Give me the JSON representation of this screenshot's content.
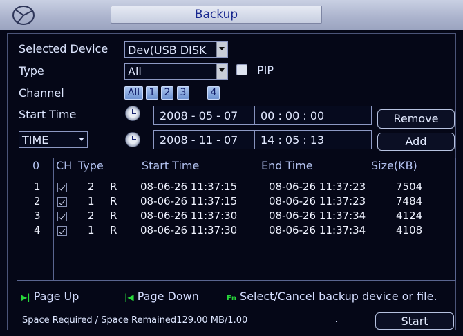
{
  "window": {
    "title": "Backup"
  },
  "form": {
    "selected_device_label": "Selected Device",
    "selected_device_value": "Dev(USB DISK",
    "type_label": "Type",
    "type_value": "All",
    "pip_label": "PIP",
    "channel_label": "Channel",
    "channels": [
      "All",
      "1",
      "2",
      "3",
      "4"
    ],
    "start_time_label": "Start Time",
    "start_date": "2008 - 05 - 07",
    "start_clock": "00 : 00 : 00",
    "end_mode": "TIME",
    "end_date": "2008 - 11 - 07",
    "end_clock": "14 : 05 : 13",
    "remove_label": "Remove",
    "add_label": "Add"
  },
  "table": {
    "headers": {
      "index": "0",
      "ch": "CH",
      "type": "Type",
      "start": "Start Time",
      "end": "End Time",
      "size": "Size(KB)"
    },
    "rows": [
      {
        "index": "1",
        "ch": "2",
        "type": "R",
        "start": "08-06-26 11:37:15",
        "end": "08-06-26 11:37:23",
        "size": "7504"
      },
      {
        "index": "2",
        "ch": "1",
        "type": "R",
        "start": "08-06-26 11:37:15",
        "end": "08-06-26 11:37:23",
        "size": "7484"
      },
      {
        "index": "3",
        "ch": "2",
        "type": "R",
        "start": "08-06-26 11:37:30",
        "end": "08-06-26 11:37:34",
        "size": "4124"
      },
      {
        "index": "4",
        "ch": "1",
        "type": "R",
        "start": "08-06-26 11:37:30",
        "end": "08-06-26 11:37:34",
        "size": "4108"
      }
    ]
  },
  "hints": {
    "page_up_icon": "▶|",
    "page_up": "Page Up",
    "page_down_icon": "|◀",
    "page_down": "Page Down",
    "fn_icon": "Fn",
    "fn_text": "Select/Cancel backup device or file."
  },
  "status": {
    "space_text": "Space Required / Space Remained129.00 MB/1.00"
  },
  "start_label": "Start",
  "colors": {
    "accent_green": "#27d83a",
    "title_text": "#18288f",
    "background": "#050717"
  }
}
